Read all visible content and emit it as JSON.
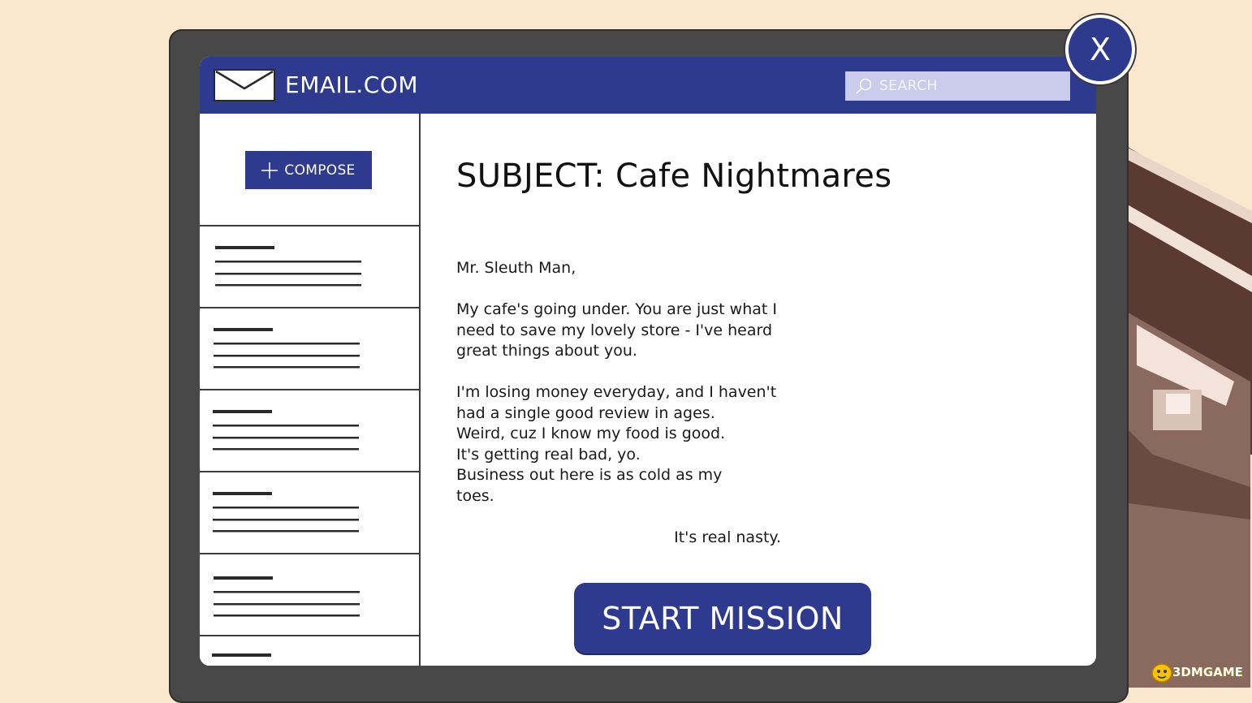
{
  "app": {
    "title": "EMAIL.COM",
    "search_placeholder": "SEARCH"
  },
  "sidebar": {
    "compose_label": "COMPOSE",
    "mail_items_count": 6
  },
  "email": {
    "subject": "SUBJECT: Cafe Nightmares",
    "greeting": "Mr. Sleuth Man,",
    "paragraph1": [
      "My cafe's going under. You are just what I",
      "need to save my lovely store - I've heard",
      "great things about you."
    ],
    "paragraph2": [
      "I'm losing money everyday, and I haven't",
      "had a single good review in ages.",
      "Weird, cuz I know my food is good.",
      "It's getting real bad, yo.",
      "Business out here is as cold as my",
      "toes."
    ],
    "signoff": "It's real nasty."
  },
  "actions": {
    "start_mission_label": "START MISSION",
    "close_label": "X"
  },
  "watermark": {
    "text": "3DMGAME"
  },
  "colors": {
    "primary": "#2d3a8e",
    "background": "#fbe7cd",
    "bezel": "#484848",
    "search_bg": "#c9ccea"
  }
}
